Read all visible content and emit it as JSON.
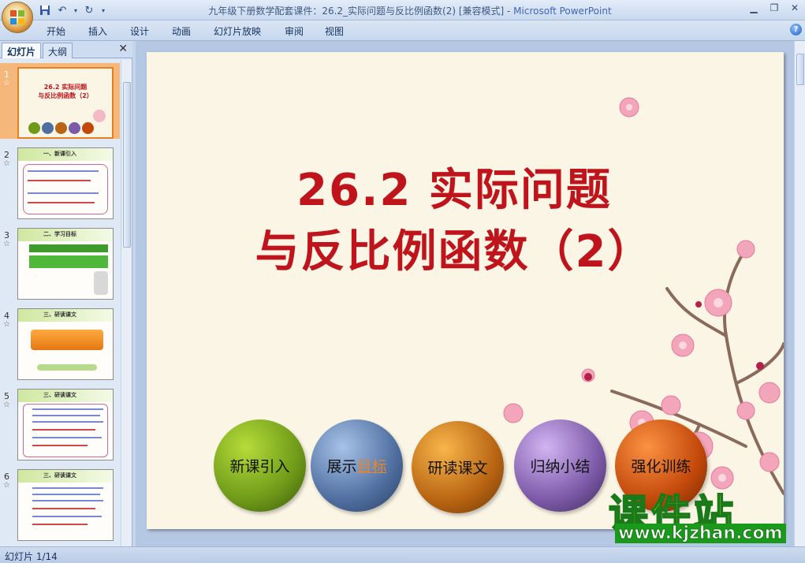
{
  "window": {
    "title": "九年级下册数学配套课件：26.2_实际问题与反比例函数(2) [兼容模式] - ",
    "app_name": "Microsoft PowerPoint"
  },
  "ribbon": {
    "tabs": [
      "开始",
      "插入",
      "设计",
      "动画",
      "幻灯片放映",
      "审阅",
      "视图"
    ]
  },
  "panel": {
    "tab_slides": "幻灯片",
    "tab_outline": "大纲",
    "thumbnails": [
      {
        "num": "1",
        "title1": "26.2 实际问题",
        "title2": "与反比例函数（2）"
      },
      {
        "num": "2",
        "header": "一、新课引入"
      },
      {
        "num": "3",
        "header": "二、学习目标"
      },
      {
        "num": "4",
        "header": "三、研读课文"
      },
      {
        "num": "5",
        "header": "三、研读课文"
      },
      {
        "num": "6",
        "header": "三、研读课文"
      }
    ]
  },
  "slide": {
    "title_line1": "26.2 实际问题",
    "title_line2": "与反比例函数（2）",
    "buttons": [
      {
        "label": "新课引入",
        "color": "#6e9a18"
      },
      {
        "label_a": "展示",
        "label_b": "目标",
        "color": "#4f6fa0"
      },
      {
        "label": "研读课文",
        "color": "#b86412"
      },
      {
        "label": "归纳小结",
        "color": "#7c5aa8"
      },
      {
        "label": "强化训练",
        "color": "#c2480a"
      }
    ]
  },
  "watermark": {
    "main": "课件站",
    "url": "www.kjzhan.com"
  },
  "status": {
    "slide_counter": "幻灯片 1/14"
  }
}
